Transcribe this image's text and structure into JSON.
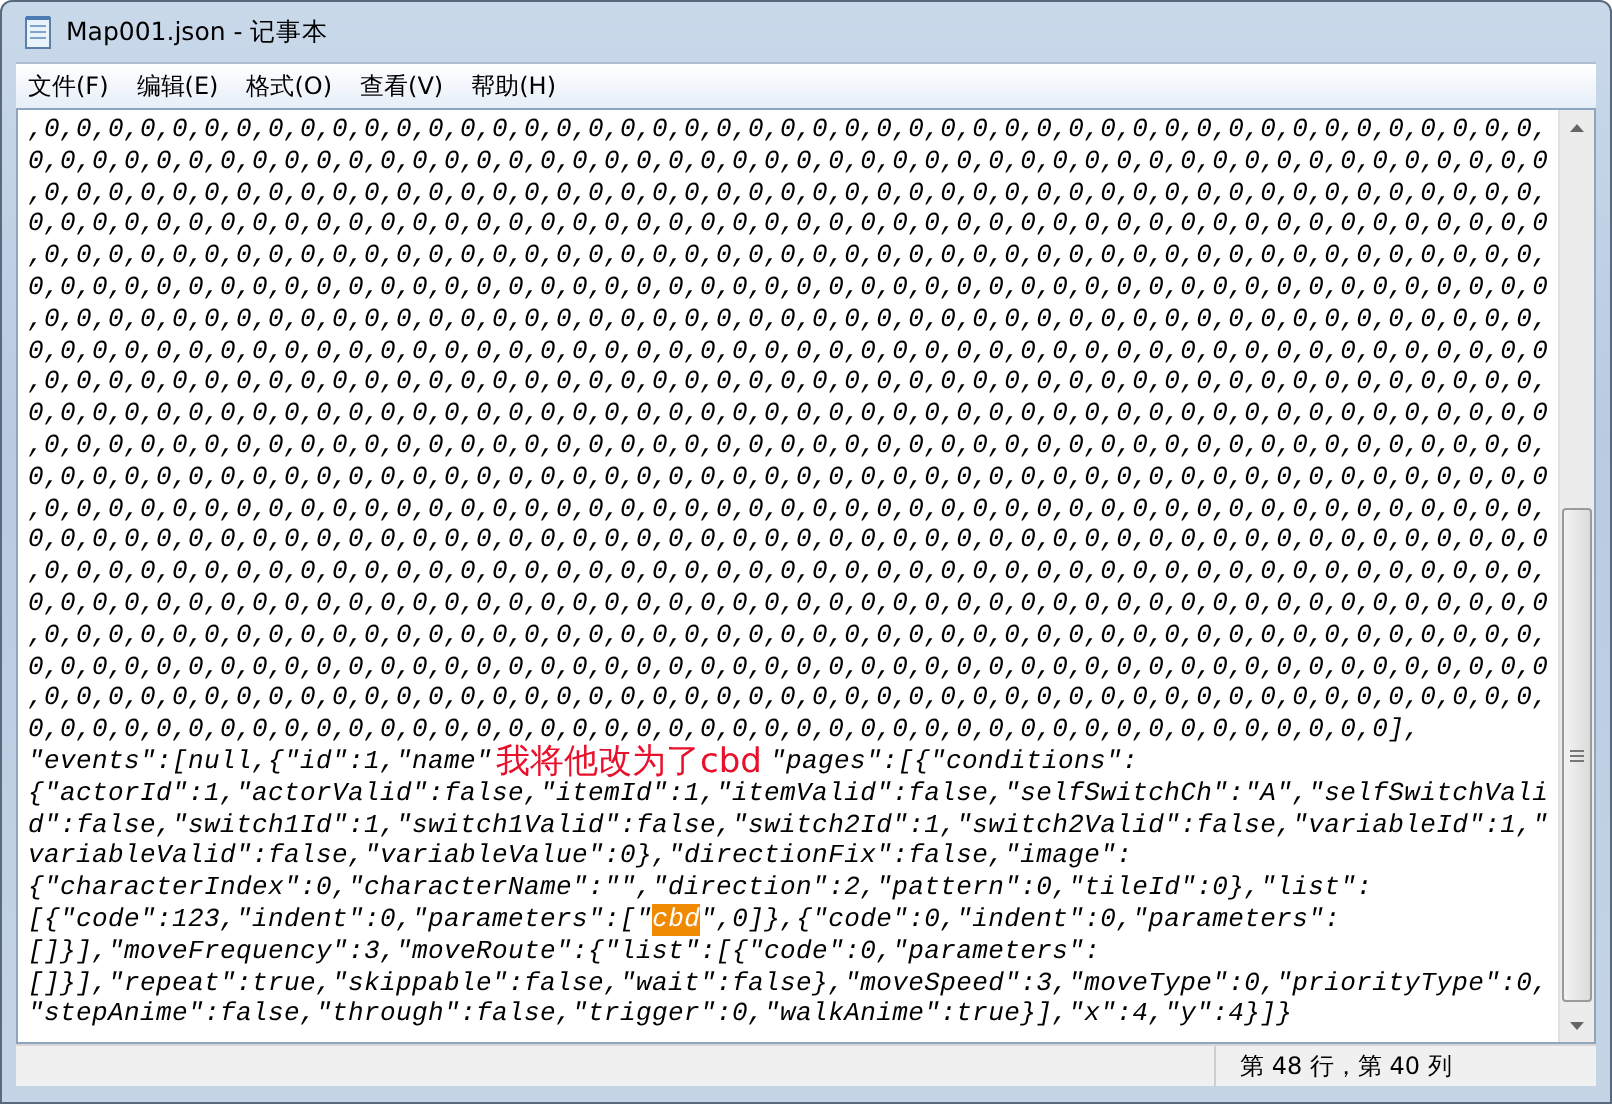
{
  "window": {
    "title": "Map001.json - 记事本"
  },
  "menu": [
    {
      "label": "文件(F)"
    },
    {
      "label": "编辑(E)"
    },
    {
      "label": "格式(O)"
    },
    {
      "label": "查看(V)"
    },
    {
      "label": "帮助(H)"
    }
  ],
  "editor": {
    "lines": [
      {
        "parts": [
          {
            "kind": "text",
            "text": ",0,0,0,0,0,0,0,0,0,0,0,0,0,0,0,0,0,0,0,0,0,0,0,0,0,0,0,0,0,0,0,0,0,0,0,0,0,0,0,0,0,0,0,0,0,0,0,"
          }
        ]
      },
      {
        "parts": [
          {
            "kind": "text",
            "text": "0,0,0,0,0,0,0,0,0,0,0,0,0,0,0,0,0,0,0,0,0,0,0,0,0,0,0,0,0,0,0,0,0,0,0,0,0,0,0,0,0,0,0,0,0,0,0,0"
          }
        ]
      },
      {
        "parts": [
          {
            "kind": "text",
            "text": ",0,0,0,0,0,0,0,0,0,0,0,0,0,0,0,0,0,0,0,0,0,0,0,0,0,0,0,0,0,0,0,0,0,0,0,0,0,0,0,0,0,0,0,0,0,0,0,"
          }
        ]
      },
      {
        "parts": [
          {
            "kind": "text",
            "text": "0,0,0,0,0,0,0,0,0,0,0,0,0,0,0,0,0,0,0,0,0,0,0,0,0,0,0,0,0,0,0,0,0,0,0,0,0,0,0,0,0,0,0,0,0,0,0,0"
          }
        ]
      },
      {
        "parts": [
          {
            "kind": "text",
            "text": ",0,0,0,0,0,0,0,0,0,0,0,0,0,0,0,0,0,0,0,0,0,0,0,0,0,0,0,0,0,0,0,0,0,0,0,0,0,0,0,0,0,0,0,0,0,0,0,"
          }
        ]
      },
      {
        "parts": [
          {
            "kind": "text",
            "text": "0,0,0,0,0,0,0,0,0,0,0,0,0,0,0,0,0,0,0,0,0,0,0,0,0,0,0,0,0,0,0,0,0,0,0,0,0,0,0,0,0,0,0,0,0,0,0,0"
          }
        ]
      },
      {
        "parts": [
          {
            "kind": "text",
            "text": ",0,0,0,0,0,0,0,0,0,0,0,0,0,0,0,0,0,0,0,0,0,0,0,0,0,0,0,0,0,0,0,0,0,0,0,0,0,0,0,0,0,0,0,0,0,0,0,"
          }
        ]
      },
      {
        "parts": [
          {
            "kind": "text",
            "text": "0,0,0,0,0,0,0,0,0,0,0,0,0,0,0,0,0,0,0,0,0,0,0,0,0,0,0,0,0,0,0,0,0,0,0,0,0,0,0,0,0,0,0,0,0,0,0,0"
          }
        ]
      },
      {
        "parts": [
          {
            "kind": "text",
            "text": ",0,0,0,0,0,0,0,0,0,0,0,0,0,0,0,0,0,0,0,0,0,0,0,0,0,0,0,0,0,0,0,0,0,0,0,0,0,0,0,0,0,0,0,0,0,0,0,"
          }
        ]
      },
      {
        "parts": [
          {
            "kind": "text",
            "text": "0,0,0,0,0,0,0,0,0,0,0,0,0,0,0,0,0,0,0,0,0,0,0,0,0,0,0,0,0,0,0,0,0,0,0,0,0,0,0,0,0,0,0,0,0,0,0,0"
          }
        ]
      },
      {
        "parts": [
          {
            "kind": "text",
            "text": ",0,0,0,0,0,0,0,0,0,0,0,0,0,0,0,0,0,0,0,0,0,0,0,0,0,0,0,0,0,0,0,0,0,0,0,0,0,0,0,0,0,0,0,0,0,0,0,"
          }
        ]
      },
      {
        "parts": [
          {
            "kind": "text",
            "text": "0,0,0,0,0,0,0,0,0,0,0,0,0,0,0,0,0,0,0,0,0,0,0,0,0,0,0,0,0,0,0,0,0,0,0,0,0,0,0,0,0,0,0,0,0,0,0,0"
          }
        ]
      },
      {
        "parts": [
          {
            "kind": "text",
            "text": ",0,0,0,0,0,0,0,0,0,0,0,0,0,0,0,0,0,0,0,0,0,0,0,0,0,0,0,0,0,0,0,0,0,0,0,0,0,0,0,0,0,0,0,0,0,0,0,"
          }
        ]
      },
      {
        "parts": [
          {
            "kind": "text",
            "text": "0,0,0,0,0,0,0,0,0,0,0,0,0,0,0,0,0,0,0,0,0,0,0,0,0,0,0,0,0,0,0,0,0,0,0,0,0,0,0,0,0,0,0,0,0,0,0,0"
          }
        ]
      },
      {
        "parts": [
          {
            "kind": "text",
            "text": ",0,0,0,0,0,0,0,0,0,0,0,0,0,0,0,0,0,0,0,0,0,0,0,0,0,0,0,0,0,0,0,0,0,0,0,0,0,0,0,0,0,0,0,0,0,0,0,"
          }
        ]
      },
      {
        "parts": [
          {
            "kind": "text",
            "text": "0,0,0,0,0,0,0,0,0,0,0,0,0,0,0,0,0,0,0,0,0,0,0,0,0,0,0,0,0,0,0,0,0,0,0,0,0,0,0,0,0,0,0,0,0,0,0,0"
          }
        ]
      },
      {
        "parts": [
          {
            "kind": "text",
            "text": ",0,0,0,0,0,0,0,0,0,0,0,0,0,0,0,0,0,0,0,0,0,0,0,0,0,0,0,0,0,0,0,0,0,0,0,0,0,0,0,0,0,0,0,0,0,0,0,"
          }
        ]
      },
      {
        "parts": [
          {
            "kind": "text",
            "text": "0,0,0,0,0,0,0,0,0,0,0,0,0,0,0,0,0,0,0,0,0,0,0,0,0,0,0,0,0,0,0,0,0,0,0,0,0,0,0,0,0,0,0,0,0,0,0,0"
          }
        ]
      },
      {
        "parts": [
          {
            "kind": "text",
            "text": ",0,0,0,0,0,0,0,0,0,0,0,0,0,0,0,0,0,0,0,0,0,0,0,0,0,0,0,0,0,0,0,0,0,0,0,0,0,0,0,0,0,0,0,0,0,0,0,"
          }
        ]
      },
      {
        "parts": [
          {
            "kind": "text",
            "text": "0,0,0,0,0,0,0,0,0,0,0,0,0,0,0,0,0,0,0,0,0,0,0,0,0,0,0,0,0,0,0,0,0,0,0,0,0,0,0,0,0,0,0],"
          }
        ]
      },
      {
        "parts": [
          {
            "kind": "text",
            "text": "\"events\":[null,{\"id\":1,\"name\""
          },
          {
            "kind": "annotation",
            "text": "我将他改为了cbd"
          },
          {
            "kind": "text",
            "text": "\"pages\":[{\"conditions\":"
          }
        ]
      },
      {
        "parts": [
          {
            "kind": "text",
            "text": "{\"actorId\":1,\"actorValid\":false,\"itemId\":1,\"itemValid\":false,\"selfSwitchCh\":\"A\",\"selfSwitchVali"
          }
        ]
      },
      {
        "parts": [
          {
            "kind": "text",
            "text": "d\":false,\"switch1Id\":1,\"switch1Valid\":false,\"switch2Id\":1,\"switch2Valid\":false,\"variableId\":1,\""
          }
        ]
      },
      {
        "parts": [
          {
            "kind": "text",
            "text": "variableValid\":false,\"variableValue\":0},\"directionFix\":false,\"image\":"
          }
        ]
      },
      {
        "parts": [
          {
            "kind": "text",
            "text": "{\"characterIndex\":0,\"characterName\":\"\",\"direction\":2,\"pattern\":0,\"tileId\":0},\"list\":"
          }
        ]
      },
      {
        "parts": [
          {
            "kind": "text",
            "text": "[{\"code\":123,\"indent\":0,\"parameters\":[\""
          },
          {
            "kind": "selection",
            "text": "cbd"
          },
          {
            "kind": "text",
            "text": "\",0]},{\"code\":0,\"indent\":0,\"parameters\":"
          }
        ]
      },
      {
        "parts": [
          {
            "kind": "text",
            "text": "[]}],\"moveFrequency\":3,\"moveRoute\":{\"list\":[{\"code\":0,\"parameters\":"
          }
        ]
      },
      {
        "parts": [
          {
            "kind": "text",
            "text": "[]}],\"repeat\":true,\"skippable\":false,\"wait\":false},\"moveSpeed\":3,\"moveType\":0,\"priorityType\":0,"
          }
        ]
      },
      {
        "parts": [
          {
            "kind": "text",
            "text": "\"stepAnime\":false,\"through\":false,\"trigger\":0,\"walkAnime\":true}],\"x\":4,\"y\":4}]}"
          }
        ]
      }
    ]
  },
  "status_bar": {
    "position": "第 48 行，第 40 列"
  }
}
